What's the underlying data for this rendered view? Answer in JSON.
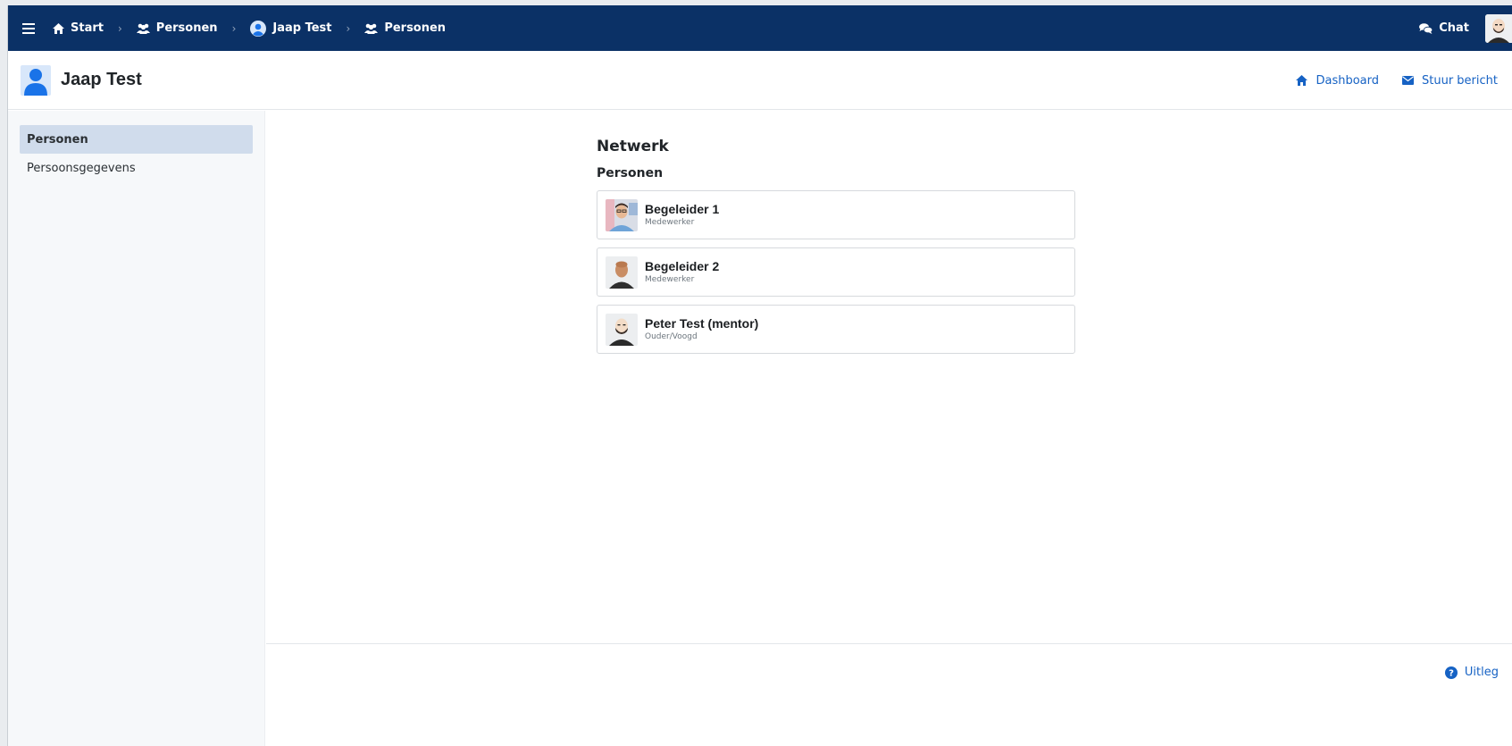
{
  "topbar": {
    "breadcrumbs": [
      {
        "label": "Start",
        "icon": "home-icon"
      },
      {
        "label": "Personen",
        "icon": "people-icon"
      },
      {
        "label": "Jaap Test",
        "icon": "user-circle-icon"
      },
      {
        "label": "Personen",
        "icon": "people-icon"
      }
    ],
    "chat_label": "Chat",
    "background": "#0b3166"
  },
  "header": {
    "title": "Jaap Test",
    "dashboard_label": "Dashboard",
    "message_label": "Stuur bericht",
    "link_color": "#1662c4"
  },
  "sidebar": {
    "items": [
      {
        "label": "Personen",
        "active": true
      },
      {
        "label": "Persoonsgegevens",
        "active": false
      }
    ]
  },
  "main": {
    "heading": "Netwerk",
    "subheading": "Personen",
    "persons": [
      {
        "name": "Begeleider 1",
        "role": "Medewerker"
      },
      {
        "name": "Begeleider 2",
        "role": "Medewerker"
      },
      {
        "name": "Peter Test (mentor)",
        "role": "Ouder/Voogd"
      }
    ]
  },
  "footer": {
    "help_label": "Uitleg"
  }
}
